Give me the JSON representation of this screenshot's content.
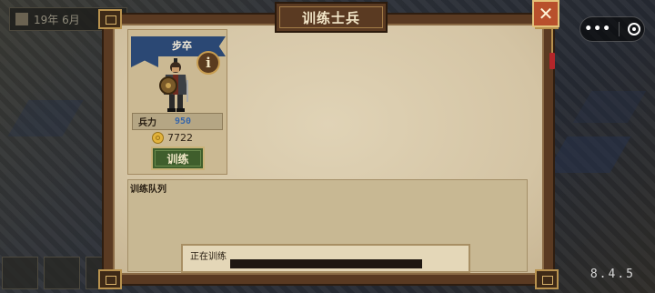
{
  "hud": {
    "date": "19年 6月"
  },
  "dialog": {
    "title": "训练士兵",
    "close_label": "✕"
  },
  "unit": {
    "name": "步卒",
    "info_label": "i",
    "troops_label": "兵力",
    "troops_value": "950",
    "cost": "7722",
    "train_label": "训练"
  },
  "queue": {
    "title": "训练队列",
    "status_label": "正在训练"
  },
  "version": "8.4.5",
  "capsule": {
    "more": "•••"
  },
  "colors": {
    "banner": "#2b4874",
    "close": "#b8502c",
    "train_button": "#3f5e2c",
    "troop_value": "#3765a8"
  }
}
